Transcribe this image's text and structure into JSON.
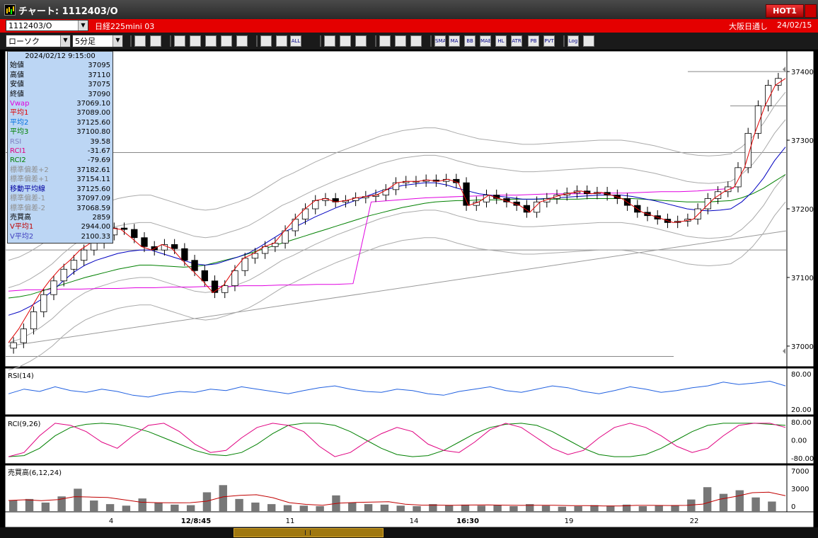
{
  "window": {
    "title": "チャート: 1112403/O",
    "hot_label": "HOT1"
  },
  "infobar": {
    "symbol": "1112403/O",
    "instrument": "日経225mini 03",
    "session": "大阪日通し",
    "date": "24/02/15"
  },
  "toolbar": {
    "chart_type": "ローソク",
    "interval": "5分足",
    "buttons": [
      {
        "name": "zoom-button",
        "label": ""
      },
      {
        "name": "bars-button",
        "label": ""
      },
      {
        "name": "draw-lines-button",
        "label": ""
      },
      {
        "name": "search-button",
        "label": ""
      },
      {
        "name": "chart-image-button",
        "label": ""
      },
      {
        "name": "compare-button",
        "label": ""
      },
      {
        "name": "disabled-button",
        "label": ""
      },
      {
        "name": "candle-a-button",
        "label": ""
      },
      {
        "name": "candle-b-button",
        "label": ""
      },
      {
        "name": "all-button",
        "label": "ALL"
      },
      {
        "name": "pen-button",
        "label": ""
      },
      {
        "name": "cursor-button",
        "label": ""
      },
      {
        "name": "undo-button",
        "label": ""
      },
      {
        "name": "settings-button",
        "label": ""
      },
      {
        "name": "tools-button",
        "label": ""
      },
      {
        "name": "color-button",
        "label": ""
      },
      {
        "name": "ind-sma-button",
        "label": "SMA"
      },
      {
        "name": "ind-ma-button",
        "label": "MA"
      },
      {
        "name": "ind-bb-button",
        "label": "BB"
      },
      {
        "name": "ind-mae-button",
        "label": "MAE"
      },
      {
        "name": "ind-hl-button",
        "label": "HL"
      },
      {
        "name": "ind-atr-button",
        "label": "ATR"
      },
      {
        "name": "ind-pb-button",
        "label": "PB"
      },
      {
        "name": "ind-pvt-button",
        "label": "PVT"
      },
      {
        "name": "log-button",
        "label": "Log"
      },
      {
        "name": "export-button",
        "label": ""
      }
    ]
  },
  "ohlc_panel": {
    "timestamp": "2024/02/12 9:15:00",
    "rows": [
      {
        "label": "始値",
        "value": "37095",
        "color": "#000000"
      },
      {
        "label": "高値",
        "value": "37110",
        "color": "#000000"
      },
      {
        "label": "安値",
        "value": "37075",
        "color": "#000000"
      },
      {
        "label": "終値",
        "value": "37090",
        "color": "#000000"
      },
      {
        "label": "Vwap",
        "value": "37069.10",
        "color": "#e000e0"
      },
      {
        "label": "平均1",
        "value": "37089.00",
        "color": "#e00000"
      },
      {
        "label": "平均2",
        "value": "37125.60",
        "color": "#0070e0"
      },
      {
        "label": "平均3",
        "value": "37100.80",
        "color": "#008000"
      },
      {
        "label": "RSI",
        "value": "39.58",
        "color": "#8080c0"
      },
      {
        "label": "RCI1",
        "value": "-31.67",
        "color": "#e00080"
      },
      {
        "label": "RCI2",
        "value": "-79.69",
        "color": "#008000"
      },
      {
        "label": "標準偏差+2",
        "value": "37182.61",
        "color": "#909090"
      },
      {
        "label": "標準偏差+1",
        "value": "37154.11",
        "color": "#909090"
      },
      {
        "label": "移動平均線",
        "value": "37125.60",
        "color": "#0000a0"
      },
      {
        "label": "標準偏差-1",
        "value": "37097.09",
        "color": "#909090"
      },
      {
        "label": "標準偏差-2",
        "value": "37068.59",
        "color": "#909090"
      },
      {
        "label": "売買高",
        "value": "2859",
        "color": "#000000"
      },
      {
        "label": "V平均1",
        "value": "2944.00",
        "color": "#c00000"
      },
      {
        "label": "V平均2",
        "value": "2100.33",
        "color": "#4040c0"
      }
    ]
  },
  "chart_data": {
    "type": "line",
    "main_y_ticks": [
      "37400",
      "37300",
      "37200",
      "37100",
      "37000"
    ],
    "x_ticks": [
      "4",
      "12/8:45",
      "11",
      "14",
      "16:30",
      "19",
      "22"
    ],
    "panels": [
      {
        "label": "RSI(14)",
        "y_ticks": [
          "80.00",
          "20.00"
        ]
      },
      {
        "label": "RCI(9,26)",
        "y_ticks": [
          "80.00",
          "0.00",
          "-80.00"
        ]
      },
      {
        "label": "売買高(6,12,24)",
        "y_ticks": [
          "7000",
          "3000",
          "0"
        ]
      }
    ],
    "ylim": [
      36970,
      37430
    ],
    "price_series": [
      37005,
      37025,
      37050,
      37075,
      37095,
      37112,
      37125,
      37140,
      37150,
      37162,
      37172,
      37170,
      37158,
      37145,
      37140,
      37148,
      37142,
      37125,
      37110,
      37095,
      37078,
      37088,
      37110,
      37128,
      37135,
      37145,
      37150,
      37168,
      37185,
      37200,
      37212,
      37215,
      37210,
      37212,
      37216,
      37218,
      37220,
      37228,
      37238,
      37240,
      37240,
      37242,
      37240,
      37243,
      37238,
      37205,
      37210,
      37220,
      37215,
      37210,
      37205,
      37195,
      37210,
      37215,
      37220,
      37223,
      37226,
      37222,
      37224,
      37220,
      37215,
      37205,
      37195,
      37190,
      37185,
      37180,
      37182,
      37185,
      37200,
      37215,
      37225,
      37232,
      37260,
      37310,
      37350,
      37380,
      37390
    ],
    "ma_blue": [
      37045,
      37050,
      37058,
      37068,
      37080,
      37095,
      37108,
      37118,
      37125,
      37130,
      37135,
      37138,
      37140,
      37140,
      37135,
      37130,
      37125,
      37120,
      37118,
      37120,
      37125,
      37130,
      37136,
      37145,
      37155,
      37165,
      37172,
      37180,
      37188,
      37195,
      37202,
      37208,
      37214,
      37220,
      37226,
      37230,
      37234,
      37236,
      37238,
      37238,
      37235,
      37230,
      37226,
      37222,
      37220,
      37218,
      37216,
      37214,
      37214,
      37215,
      37216,
      37217,
      37218,
      37219,
      37220,
      37220,
      37220,
      37218,
      37215,
      37212,
      37208,
      37204,
      37200,
      37198,
      37197,
      37198,
      37200,
      37210,
      37225,
      37245,
      37270,
      37290
    ],
    "ma_green": [
      37070,
      37072,
      37075,
      37080,
      37085,
      37090,
      37095,
      37100,
      37104,
      37108,
      37112,
      37115,
      37118,
      37118,
      37117,
      37116,
      37115,
      37116,
      37118,
      37122,
      37126,
      37130,
      37135,
      37140,
      37145,
      37150,
      37155,
      37160,
      37165,
      37170,
      37175,
      37180,
      37185,
      37190,
      37194,
      37198,
      37202,
      37205,
      37208,
      37210,
      37211,
      37212,
      37212,
      37213,
      37213,
      37213,
      37214,
      37214,
      37214,
      37214,
      37214,
      37214,
      37214,
      37215,
      37215,
      37215,
      37215,
      37215,
      37214,
      37213,
      37212,
      37211,
      37210,
      37210,
      37210,
      37211,
      37212,
      37216,
      37222,
      37230,
      37240,
      37250
    ],
    "vwap": [
      37080,
      37082,
      37082,
      37083,
      37083,
      37084,
      37084,
      37085,
      37085,
      37086,
      37086,
      37087,
      37087,
      37088,
      37088,
      37089,
      37089,
      37090,
      37090,
      37091,
      37210,
      37212,
      37214,
      37216,
      37217,
      37218,
      37219,
      37220,
      37220,
      37221,
      37222,
      37222,
      37222,
      37223,
      37223,
      37224,
      37225,
      37225,
      37226,
      37228,
      37230
    ],
    "rsi": [
      45,
      55,
      50,
      60,
      52,
      48,
      55,
      50,
      42,
      38,
      45,
      50,
      48,
      55,
      52,
      60,
      55,
      50,
      45,
      52,
      58,
      62,
      55,
      50,
      48,
      55,
      52,
      45,
      42,
      50,
      55,
      60,
      52,
      48,
      55,
      62,
      58,
      50,
      45,
      52,
      60,
      55,
      48,
      52,
      58,
      62,
      70,
      65,
      68,
      72,
      62
    ],
    "rci1": [
      -80,
      -60,
      20,
      80,
      70,
      40,
      -10,
      -40,
      20,
      70,
      80,
      40,
      -20,
      -60,
      -50,
      10,
      60,
      80,
      70,
      40,
      -30,
      -80,
      -60,
      -10,
      30,
      60,
      40,
      -20,
      -50,
      -60,
      -10,
      50,
      80,
      60,
      10,
      -40,
      -70,
      -50,
      10,
      60,
      80,
      60,
      20,
      -30,
      -60,
      -40,
      20,
      70,
      80,
      80,
      60
    ],
    "rci2": [
      -80,
      -75,
      -40,
      20,
      60,
      75,
      80,
      75,
      60,
      40,
      10,
      -20,
      -50,
      -70,
      -75,
      -60,
      -20,
      30,
      70,
      80,
      80,
      70,
      40,
      0,
      -40,
      -70,
      -80,
      -75,
      -50,
      -10,
      30,
      60,
      75,
      80,
      70,
      40,
      0,
      -40,
      -70,
      -80,
      -80,
      -70,
      -40,
      0,
      40,
      70,
      80,
      80,
      80,
      75,
      70
    ],
    "volume": [
      2200,
      2500,
      1800,
      3000,
      4500,
      2200,
      1500,
      1200,
      2600,
      1800,
      1400,
      1300,
      3800,
      5200,
      2500,
      1800,
      1500,
      1300,
      1200,
      1100,
      3200,
      1800,
      1500,
      1400,
      1200,
      1100,
      1500,
      1300,
      1400,
      1200,
      1300,
      1100,
      1500,
      1200,
      1000,
      1100,
      1300,
      1200,
      1400,
      1100,
      1200,
      1300,
      2400,
      4800,
      3500,
      4200,
      2800,
      2000
    ]
  }
}
